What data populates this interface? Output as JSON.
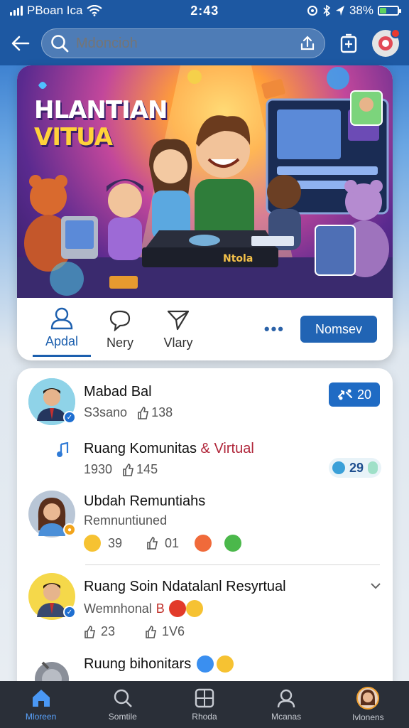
{
  "status_bar": {
    "carrier": "PBoan Ica",
    "time": "2:43",
    "battery": "38%",
    "battery_level": 0.38
  },
  "header": {
    "back_icon": "arrow-left-icon",
    "search_placeholder": "Mdoncioh",
    "share_icon": "share-icon",
    "add_icon": "add-square-icon",
    "profile_icon": "profile-avatar-icon"
  },
  "hero": {
    "title_line1": "HLANTIAN",
    "title_line2": "VITUA",
    "console_label": "Ntola",
    "actions": [
      {
        "label": "Apdal",
        "icon": "person-icon",
        "active": true
      },
      {
        "label": "Nery",
        "icon": "comment-icon",
        "active": false
      },
      {
        "label": "Vlary",
        "icon": "send-icon",
        "active": false
      }
    ],
    "more_label": "•••",
    "primary_button": "Nomsev"
  },
  "feed": [
    {
      "name": "Mabad Bal",
      "meta_left": "S3sano",
      "meta_likes": "138",
      "badge": "20",
      "badge_icon": "share-icon",
      "avatar": "man-avatar"
    },
    {
      "name_part1": "Ruang Komunitas ",
      "name_part2": "& Virtual",
      "meta_left": "1930",
      "meta_likes": "145",
      "badge": "29",
      "badge_icon": "music-note-icon"
    },
    {
      "name": "Ubdah Remuntiahs",
      "subtitle": "Remnuntiuned",
      "reaction_count": "39",
      "reaction2": "01",
      "avatar": "woman-avatar"
    },
    {
      "name": "Ruang Soin Ndatalanl Resyrtual",
      "subtitle": "Wemnhonal",
      "subtitle_suffix": "B",
      "meta_left": "23",
      "meta_right": "1V6",
      "avatar": "man-avatar-2"
    },
    {
      "name": "Ruung bihonitars",
      "avatar": "robot-avatar"
    }
  ],
  "tabs": [
    {
      "label": "Mloreen",
      "icon": "home-icon",
      "active": true
    },
    {
      "label": "Somtile",
      "icon": "search-icon",
      "active": false
    },
    {
      "label": "Rhoda",
      "icon": "grid-icon",
      "active": false
    },
    {
      "label": "Mcanas",
      "icon": "people-icon",
      "active": false
    },
    {
      "label": "Ivlonens",
      "icon": "profile-icon",
      "active": false
    }
  ]
}
